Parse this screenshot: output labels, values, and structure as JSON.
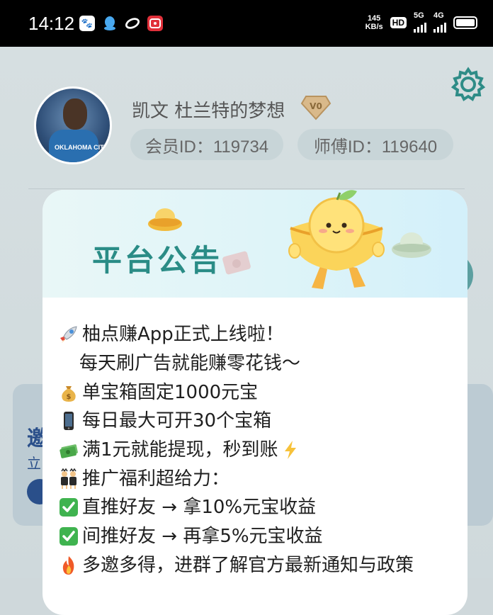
{
  "status_bar": {
    "time": "14:12",
    "speed_value": "145",
    "speed_unit": "KB/s",
    "hd_label": "HD",
    "network_1": "5G",
    "network_2": "4G",
    "apps": [
      "baidu-icon",
      "qq-icon",
      "link-icon",
      "message-icon"
    ]
  },
  "profile": {
    "username": "凯文 杜兰特的梦想",
    "vip_level": "V0",
    "member_id": "会员ID：119734",
    "master_id": "师傅ID：119640",
    "avatar_text": "OKLAHOMA CITY"
  },
  "background_card": {
    "title": "邀",
    "subtitle": "立"
  },
  "announcement": {
    "title": "平台公告",
    "lines": [
      {
        "emoji": "rocket-emoji",
        "text": "柚点赚App正式上线啦！"
      },
      {
        "emoji": "",
        "text": "每天刷广告就能赚零花钱～"
      },
      {
        "emoji": "money-bag-emoji",
        "text": "单宝箱固定1000元宝"
      },
      {
        "emoji": "phone-emoji",
        "text": "每日最大可开30个宝箱"
      },
      {
        "emoji": "money-wings-emoji",
        "text": "满1元就能提现，秒到账",
        "suffix_emoji": "lightning-emoji"
      },
      {
        "emoji": "people-emoji",
        "text": "推广福利超给力："
      },
      {
        "emoji": "check-emoji",
        "text": "直推好友 → 拿10%元宝收益"
      },
      {
        "emoji": "check-emoji",
        "text": "间推好友 → 再拿5%元宝收益"
      },
      {
        "emoji": "fire-emoji",
        "text": "多邀多得，进群了解官方最新通知与政策"
      }
    ]
  },
  "colors": {
    "status_bar": "#000000",
    "title_teal": "#2a8c86",
    "check_green": "#3fb34f",
    "overlay": "#cfd8db"
  }
}
